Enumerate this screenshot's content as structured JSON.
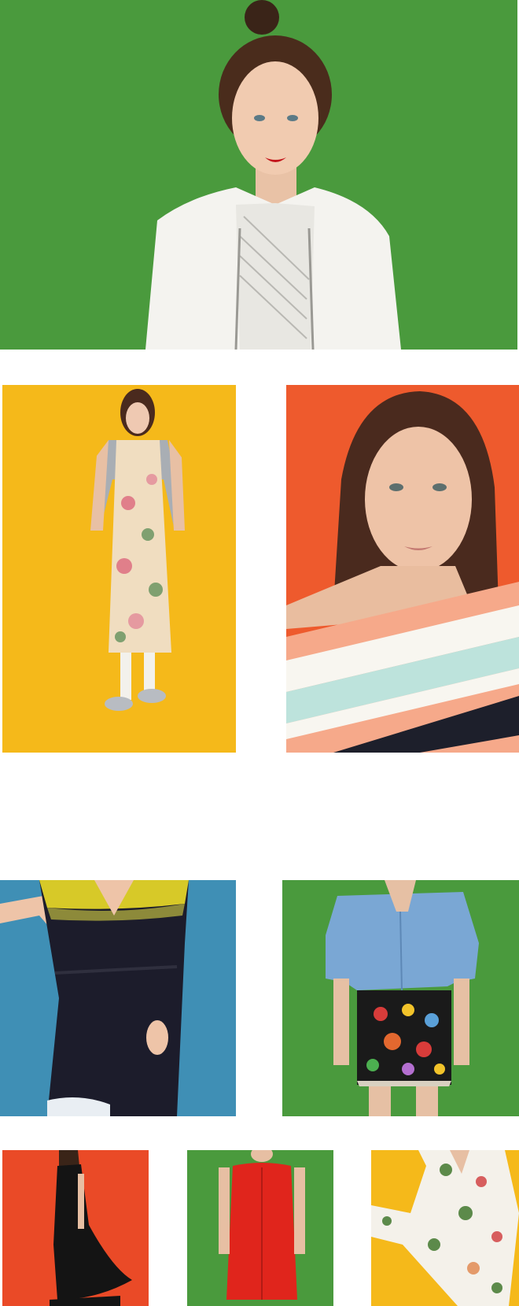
{
  "gallery": {
    "colors": {
      "green": "#4a9a3d",
      "yellow": "#f5b91a",
      "orange": "#ee5a2d",
      "teal": "#3f8fb5",
      "red": "#ea4a27",
      "white": "#ffffff"
    },
    "photos": [
      {
        "id": "hero",
        "subject": "model-white-bomber-jacket",
        "background": "green"
      },
      {
        "id": "floral-dress",
        "subject": "model-floral-midi-dress-grey-cardigan",
        "background": "yellow"
      },
      {
        "id": "striped-top",
        "subject": "model-off-shoulder-striped-top-portrait",
        "background": "orange"
      },
      {
        "id": "wrap-dress",
        "subject": "model-navy-wrap-dress-tie-dye",
        "background": "teal"
      },
      {
        "id": "denim-shirt",
        "subject": "model-denim-shirt-embroidered-skirt",
        "background": "green"
      },
      {
        "id": "black-dress",
        "subject": "model-black-slip-dress",
        "background": "red"
      },
      {
        "id": "red-dress",
        "subject": "model-red-shift-dress",
        "background": "green"
      },
      {
        "id": "floral-set",
        "subject": "model-white-floral-pyjama-set",
        "background": "yellow"
      }
    ]
  }
}
